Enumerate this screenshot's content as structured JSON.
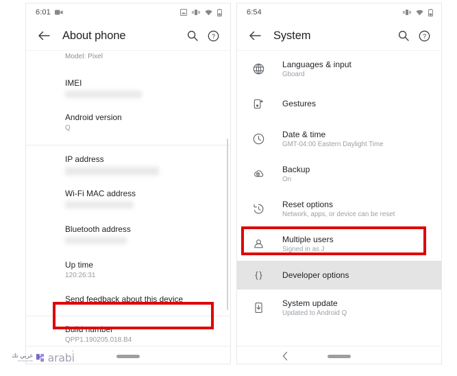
{
  "left_phone": {
    "status_bar": {
      "time": "6:01",
      "left_icons": [
        "screen-record-icon"
      ],
      "right_icons": [
        "screenshot-icon",
        "vibrate-icon",
        "wifi-icon",
        "battery-icon"
      ]
    },
    "toolbar": {
      "back_label": "Back",
      "title": "About phone",
      "search_label": "Search",
      "help_label": "Help"
    },
    "items": [
      {
        "name": "model",
        "title": "Model: Pixel",
        "value": "",
        "redacted": false,
        "muted": true,
        "partial": true
      },
      {
        "name": "imei",
        "title": "IMEI",
        "value": "",
        "redacted": true,
        "muted": false,
        "partial": false
      },
      {
        "name": "android-version",
        "title": "Android version",
        "value": "Q",
        "redacted": false,
        "muted": false,
        "partial": false
      },
      {
        "name": "ip-address",
        "title": "IP address",
        "value": "",
        "redacted": true,
        "muted": false,
        "partial": false
      },
      {
        "name": "wifi-mac-address",
        "title": "Wi-Fi MAC address",
        "value": "",
        "redacted": true,
        "muted": false,
        "partial": false
      },
      {
        "name": "bluetooth-address",
        "title": "Bluetooth address",
        "value": "",
        "redacted": true,
        "muted": false,
        "partial": false
      },
      {
        "name": "up-time",
        "title": "Up time",
        "value": "120:26:31",
        "redacted": false,
        "muted": false,
        "partial": false
      },
      {
        "name": "send-feedback",
        "title": "Send feedback about this device",
        "value": "",
        "redacted": false,
        "muted": false,
        "partial": false
      },
      {
        "name": "build-number",
        "title": "Build number",
        "value": "QPP1.190205.018.B4",
        "redacted": false,
        "muted": false,
        "partial": false
      }
    ],
    "nav": {
      "pill_label": "Home gesture pill"
    }
  },
  "right_phone": {
    "status_bar": {
      "time": "6:54",
      "right_icons": [
        "vibrate-icon",
        "wifi-icon",
        "battery-icon"
      ]
    },
    "toolbar": {
      "back_label": "Back",
      "title": "System",
      "search_label": "Search",
      "help_label": "Help"
    },
    "items": [
      {
        "name": "languages-and-input",
        "icon": "globe-icon",
        "title": "Languages & input",
        "subtitle": "Gboard",
        "highlighted": false
      },
      {
        "name": "gestures",
        "icon": "gestures-icon",
        "title": "Gestures",
        "subtitle": "",
        "highlighted": false
      },
      {
        "name": "date-and-time",
        "icon": "clock-icon",
        "title": "Date & time",
        "subtitle": "GMT-04:00 Eastern Daylight Time",
        "highlighted": false
      },
      {
        "name": "backup",
        "icon": "cloud-upload-icon",
        "title": "Backup",
        "subtitle": "On",
        "highlighted": false
      },
      {
        "name": "reset-options",
        "icon": "history-icon",
        "title": "Reset options",
        "subtitle": "Network, apps, or device can be reset",
        "highlighted": false
      },
      {
        "name": "multiple-users",
        "icon": "person-icon",
        "title": "Multiple users",
        "subtitle": "Signed in as J",
        "highlighted": false
      },
      {
        "name": "developer-options",
        "icon": "braces-icon",
        "title": "Developer options",
        "subtitle": "",
        "highlighted": true
      },
      {
        "name": "system-update",
        "icon": "system-update-icon",
        "title": "System update",
        "subtitle": "Updated to Android Q",
        "highlighted": false
      }
    ],
    "nav": {
      "back_label": "Back",
      "pill_label": "Home gesture pill"
    }
  },
  "annotations": {
    "highlight_color": "#e00000",
    "build_number_box": "Build number",
    "developer_options_box": "Developer options"
  },
  "watermark": {
    "arabic_main": "عربي تك",
    "arabic_sub": "technoarabi",
    "brand": "arabi"
  }
}
